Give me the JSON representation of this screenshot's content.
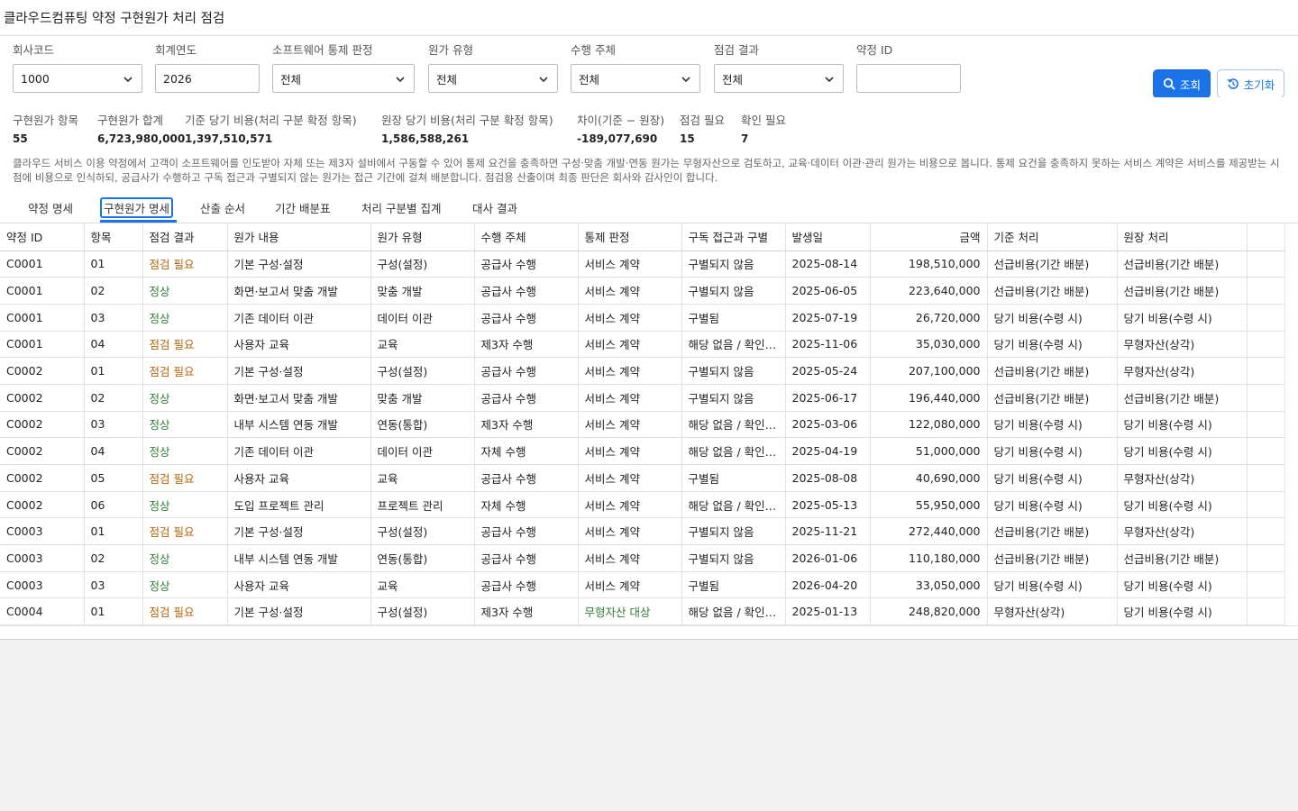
{
  "app": {
    "title": "클라우드컴퓨팅 약정 구현원가 처리 점검"
  },
  "filters": {
    "company_code": {
      "label": "회사코드",
      "value": "1000"
    },
    "fiscal_year": {
      "label": "회계연도",
      "value": "2026"
    },
    "sw_control": {
      "label": "소프트웨어 통제 판정",
      "value": "전체"
    },
    "cost_type": {
      "label": "원가 유형",
      "value": "전체"
    },
    "performer": {
      "label": "수행 주체",
      "value": "전체"
    },
    "result": {
      "label": "점검 결과",
      "value": "전체"
    },
    "contract_id": {
      "label": "약정 ID",
      "value": ""
    },
    "search_label": "조회",
    "reset_label": "초기화"
  },
  "summary": [
    {
      "label": "구현원가 항목",
      "value": "55"
    },
    {
      "label": "구현원가 합계",
      "value": "6,723,980,000"
    },
    {
      "label": "기준 당기 비용(처리 구분 확정 항목)",
      "value": "1,397,510,571"
    },
    {
      "label": "원장 당기 비용(처리 구분 확정 항목)",
      "value": "1,586,588,261"
    },
    {
      "label": "차이(기준 − 원장)",
      "value": "-189,077,690"
    },
    {
      "label": "점검 필요",
      "value": "15"
    },
    {
      "label": "확인 필요",
      "value": "7"
    }
  ],
  "description": "클라우드 서비스 이용 약정에서 고객이 소프트웨어를 인도받아 자체 또는 제3자 설비에서 구동할 수 있어 통제 요건을 충족하면 구성·맞춤 개발·연동 원가는 무형자산으로 검토하고, 교육·데이터 이관·관리 원가는 비용으로 봅니다. 통제 요건을 충족하지 못하는 서비스 계약은 서비스를 제공받는 시점에 비용으로 인식하되, 공급사가 수행하고 구독 접근과 구별되지 않는 원가는 접근 기간에 걸쳐 배분합니다. 점검용 산출이며 최종 판단은 회사와 감사인이 합니다.",
  "tabs": [
    "약정 명세",
    "구현원가 명세",
    "산출 순서",
    "기간 배분표",
    "처리 구분별 집계",
    "대사 결과"
  ],
  "active_tab": "구현원가 명세",
  "table": {
    "columns": [
      "약정 ID",
      "항목",
      "점검 결과",
      "원가 내용",
      "원가 유형",
      "수행 주체",
      "통제 판정",
      "구독 접근과 구별",
      "발생일",
      "금액",
      "기준 처리",
      "원장 처리"
    ],
    "rows": [
      [
        "C0001",
        "01",
        "점검 필요",
        "기본 구성·설정",
        "구성(설정)",
        "공급사 수행",
        "서비스 계약",
        "구별되지 않음",
        "2025-08-14",
        "198,510,000",
        "선급비용(기간 배분)",
        "선급비용(기간 배분)"
      ],
      [
        "C0001",
        "02",
        "정상",
        "화면·보고서 맞춤 개발",
        "맞춤 개발",
        "공급사 수행",
        "서비스 계약",
        "구별되지 않음",
        "2025-06-05",
        "223,640,000",
        "선급비용(기간 배분)",
        "선급비용(기간 배분)"
      ],
      [
        "C0001",
        "03",
        "정상",
        "기존 데이터 이관",
        "데이터 이관",
        "공급사 수행",
        "서비스 계약",
        "구별됨",
        "2025-07-19",
        "26,720,000",
        "당기 비용(수령 시)",
        "당기 비용(수령 시)"
      ],
      [
        "C0001",
        "04",
        "점검 필요",
        "사용자 교육",
        "교육",
        "제3자 수행",
        "서비스 계약",
        "해당 없음 / 확인 필요",
        "2025-11-06",
        "35,030,000",
        "당기 비용(수령 시)",
        "무형자산(상각)"
      ],
      [
        "C0002",
        "01",
        "점검 필요",
        "기본 구성·설정",
        "구성(설정)",
        "공급사 수행",
        "서비스 계약",
        "구별되지 않음",
        "2025-05-24",
        "207,100,000",
        "선급비용(기간 배분)",
        "무형자산(상각)"
      ],
      [
        "C0002",
        "02",
        "정상",
        "화면·보고서 맞춤 개발",
        "맞춤 개발",
        "공급사 수행",
        "서비스 계약",
        "구별되지 않음",
        "2025-06-17",
        "196,440,000",
        "선급비용(기간 배분)",
        "선급비용(기간 배분)"
      ],
      [
        "C0002",
        "03",
        "정상",
        "내부 시스템 연동 개발",
        "연동(통합)",
        "제3자 수행",
        "서비스 계약",
        "해당 없음 / 확인 필요",
        "2025-03-06",
        "122,080,000",
        "당기 비용(수령 시)",
        "당기 비용(수령 시)"
      ],
      [
        "C0002",
        "04",
        "정상",
        "기존 데이터 이관",
        "데이터 이관",
        "자체 수행",
        "서비스 계약",
        "해당 없음 / 확인 필요",
        "2025-04-19",
        "51,000,000",
        "당기 비용(수령 시)",
        "당기 비용(수령 시)"
      ],
      [
        "C0002",
        "05",
        "점검 필요",
        "사용자 교육",
        "교육",
        "공급사 수행",
        "서비스 계약",
        "구별됨",
        "2025-08-08",
        "40,690,000",
        "당기 비용(수령 시)",
        "무형자산(상각)"
      ],
      [
        "C0002",
        "06",
        "정상",
        "도입 프로젝트 관리",
        "프로젝트 관리",
        "자체 수행",
        "서비스 계약",
        "해당 없음 / 확인 필요",
        "2025-05-13",
        "55,950,000",
        "당기 비용(수령 시)",
        "당기 비용(수령 시)"
      ],
      [
        "C0003",
        "01",
        "점검 필요",
        "기본 구성·설정",
        "구성(설정)",
        "공급사 수행",
        "서비스 계약",
        "구별되지 않음",
        "2025-11-21",
        "272,440,000",
        "선급비용(기간 배분)",
        "무형자산(상각)"
      ],
      [
        "C0003",
        "02",
        "정상",
        "내부 시스템 연동 개발",
        "연동(통합)",
        "공급사 수행",
        "서비스 계약",
        "구별되지 않음",
        "2026-01-06",
        "110,180,000",
        "선급비용(기간 배분)",
        "선급비용(기간 배분)"
      ],
      [
        "C0003",
        "03",
        "정상",
        "사용자 교육",
        "교육",
        "공급사 수행",
        "서비스 계약",
        "구별됨",
        "2026-04-20",
        "33,050,000",
        "당기 비용(수령 시)",
        "당기 비용(수령 시)"
      ],
      [
        "C0004",
        "01",
        "점검 필요",
        "기본 구성·설정",
        "구성(설정)",
        "제3자 수행",
        "무형자산 대상",
        "해당 없음 / 확인 필요",
        "2025-01-13",
        "248,820,000",
        "무형자산(상각)",
        "당기 비용(수령 시)"
      ]
    ]
  },
  "colors": {
    "accent": "#1a73e8",
    "warning": "#b9650a",
    "ok": "#2e7d32"
  }
}
